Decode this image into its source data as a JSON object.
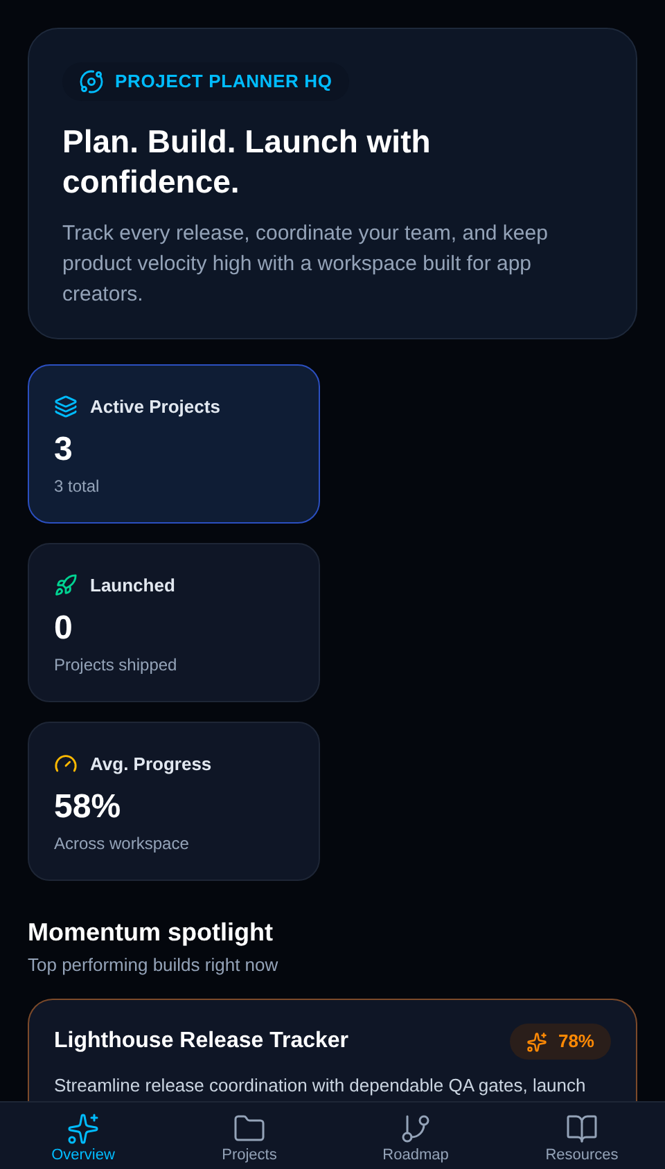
{
  "hero": {
    "badge": "PROJECT PLANNER HQ",
    "title": "Plan. Build. Launch with confidence.",
    "subtitle": "Track every release, coordinate your team, and keep product velocity high with a workspace built for app creators."
  },
  "stats": [
    {
      "kind": "layers",
      "label": "Active Projects",
      "value": "3",
      "caption": "3 total",
      "selected": true
    },
    {
      "kind": "rocket",
      "label": "Launched",
      "value": "0",
      "caption": "Projects shipped",
      "selected": false
    },
    {
      "kind": "gauge",
      "label": "Avg. Progress",
      "value": "58%",
      "caption": "Across workspace",
      "selected": false
    }
  ],
  "spotlight": {
    "title": "Momentum spotlight",
    "subtitle": "Top performing builds right now",
    "card": {
      "title": "Lighthouse Release Tracker",
      "progress": "78%",
      "description": "Streamline release coordination with dependable QA gates, launch"
    }
  },
  "nav": [
    {
      "kind": "sparkles",
      "label": "Overview",
      "selected": true
    },
    {
      "kind": "folder",
      "label": "Projects",
      "selected": false
    },
    {
      "kind": "branch",
      "label": "Roadmap",
      "selected": false
    },
    {
      "kind": "book",
      "label": "Resources",
      "selected": false
    }
  ]
}
